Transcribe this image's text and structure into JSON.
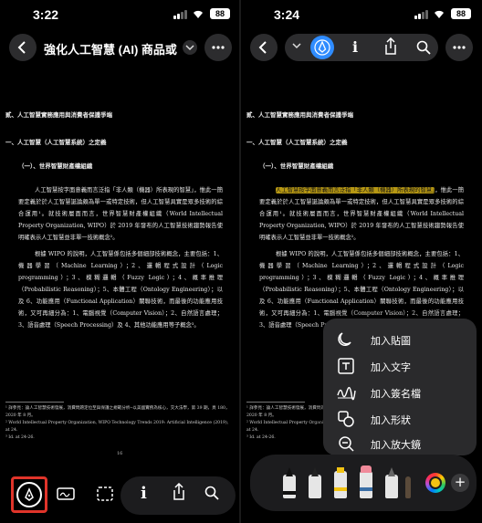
{
  "left": {
    "status": {
      "time": "3:22",
      "battery": "88"
    },
    "header": {
      "title": "強化人工智慧 (AI) 商品或…"
    },
    "toolbar": {
      "info_glyph": "i"
    }
  },
  "right": {
    "status": {
      "time": "3:24",
      "battery": "88"
    },
    "toolbar": {
      "info_glyph": "i"
    },
    "add_menu": {
      "items": [
        {
          "label": "加入貼圖",
          "icon": "sticker-icon"
        },
        {
          "label": "加入文字",
          "icon": "text-box-icon"
        },
        {
          "label": "加入簽名檔",
          "icon": "signature-icon"
        },
        {
          "label": "加入形狀",
          "icon": "shapes-icon"
        },
        {
          "label": "加入放大鏡",
          "icon": "magnifier-icon"
        }
      ]
    },
    "tray": {
      "plus": "+"
    }
  },
  "document": {
    "section": "貳、人工智慧實務應用與消費者保護爭端",
    "subsection": "一、人工智慧（人工智慧系統）之定義",
    "subsubsection": "（一）、世界智慧財產權組織",
    "para1_highlight": "人工智慧按字面意義而言泛指「非人類（機器）所表現的智慧」",
    "para1_rest": "，惟此一簡要定義於於人工智慧誕論頗為單一或特定技術，但人工智慧具實是眾多技術的綜合運用¹。就技術層面而言，世界智慧財產權組織（World Intellectual Property Organization, WIPO）於 2019 年發布的人工智慧技術趨勢報告使明確表示人工智慧並非單一技術概念²。",
    "para2": "根據 WIPO 的說明，人工智慧係包括多個細部技術概念，主要包括：1、機器學習（Machine Learning）；2、邏輯程式設計（Logic programming）；3、模糊邏輯（Fuzzy Logic）；4、概率推理（Probabilistic Reasoning）；5、本體工程（Ontology Engineering）；以及 6、功能應用（Functional Application）關聯技術，而最後的功能應用技術，又可再細分為：1、電腦視覺（Computer Vision）；2、自然語言處理；3、語音處理（Speech Processing）及 4、其他功能應用等子概念³。",
    "footnotes": [
      "¹ 詳參見：論人工智慧技術發展，消費問題定位至與保護之規範分析─以美國實務為核心，交大法學，第 39 期，頁 180，2020 年 8 月。",
      "² World Intellectual Property Organization, WIPO Technology Trends 2019: Artificial Intelligence (2019), at 24.",
      "³ Id. at 24-26."
    ],
    "page_number": "16"
  },
  "colors": {
    "accent_blue": "#2f8cff",
    "highlight": "#d6b216",
    "annotation_red": "#e0342a",
    "menu_bg": "#2a2a2c"
  }
}
